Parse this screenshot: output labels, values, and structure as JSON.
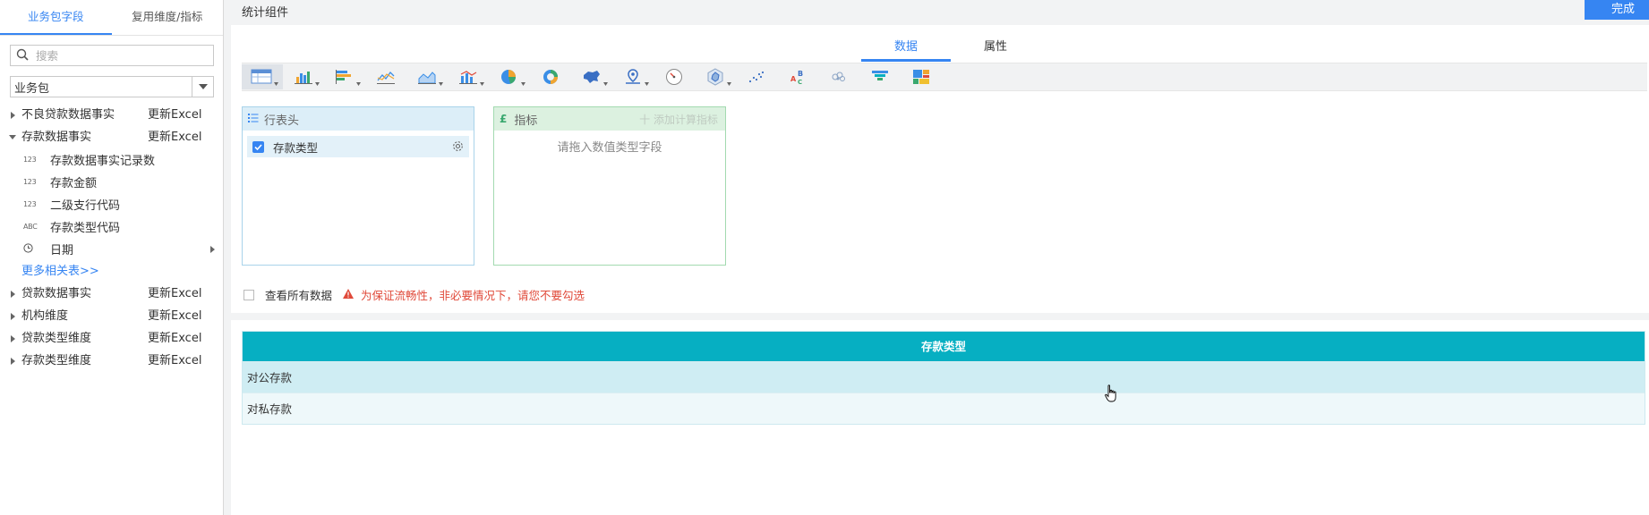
{
  "sidebar": {
    "tabs": [
      {
        "label": "业务包字段",
        "active": true
      },
      {
        "label": "复用维度/指标",
        "active": false
      }
    ],
    "search": {
      "placeholder": "搜索",
      "value": ""
    },
    "package_select": {
      "value": "业务包"
    },
    "tables": [
      {
        "label": "不良贷款数据事实",
        "action": "更新Excel",
        "expanded": false
      },
      {
        "label": "存款数据事实",
        "action": "更新Excel",
        "expanded": true,
        "fields": [
          {
            "type": "123",
            "label": "存款数据事实记录数"
          },
          {
            "type": "123",
            "label": "存款金额"
          },
          {
            "type": "123",
            "label": "二级支行代码"
          },
          {
            "type": "ABC",
            "label": "存款类型代码"
          },
          {
            "type": "date",
            "label": "日期",
            "has_children": true
          }
        ],
        "more_link": "更多相关表>>"
      },
      {
        "label": "贷款数据事实",
        "action": "更新Excel",
        "expanded": false
      },
      {
        "label": "机构维度",
        "action": "更新Excel",
        "expanded": false
      },
      {
        "label": "贷款类型维度",
        "action": "更新Excel",
        "expanded": false
      },
      {
        "label": "存款类型维度",
        "action": "更新Excel",
        "expanded": false
      }
    ]
  },
  "topbar": {
    "title": "统计组件",
    "done_label": "完成"
  },
  "main_tabs": [
    {
      "label": "数据",
      "active": true
    },
    {
      "label": "属性",
      "active": false
    }
  ],
  "toolbar_icons": [
    "table-chart-icon",
    "bar-chart-icon",
    "horizontal-bar-icon",
    "line-chart-icon",
    "area-chart-icon",
    "combo-chart-icon",
    "pie-chart-icon",
    "donut-chart-icon",
    "map-icon",
    "pin-map-icon",
    "gauge-icon",
    "radar-icon",
    "scatter-icon",
    "word-cloud-icon",
    "bubble-icon",
    "funnel-icon",
    "treemap-icon"
  ],
  "row_region": {
    "title": "行表头",
    "fields": [
      {
        "label": "存款类型",
        "checked": true
      }
    ]
  },
  "indicator_region": {
    "title": "指标",
    "add_label": "十 添加计算指标",
    "placeholder": "请拖入数值类型字段"
  },
  "view_all": {
    "label": "查看所有数据",
    "checked": false,
    "warning": "为保证流畅性，非必要情况下，请您不要勾选"
  },
  "preview_table": {
    "header": "存款类型",
    "rows": [
      "对公存款",
      "对私存款"
    ]
  },
  "colors": {
    "accent": "#3685f2",
    "table_header": "#06afc2",
    "warning": "#e04a3a"
  }
}
